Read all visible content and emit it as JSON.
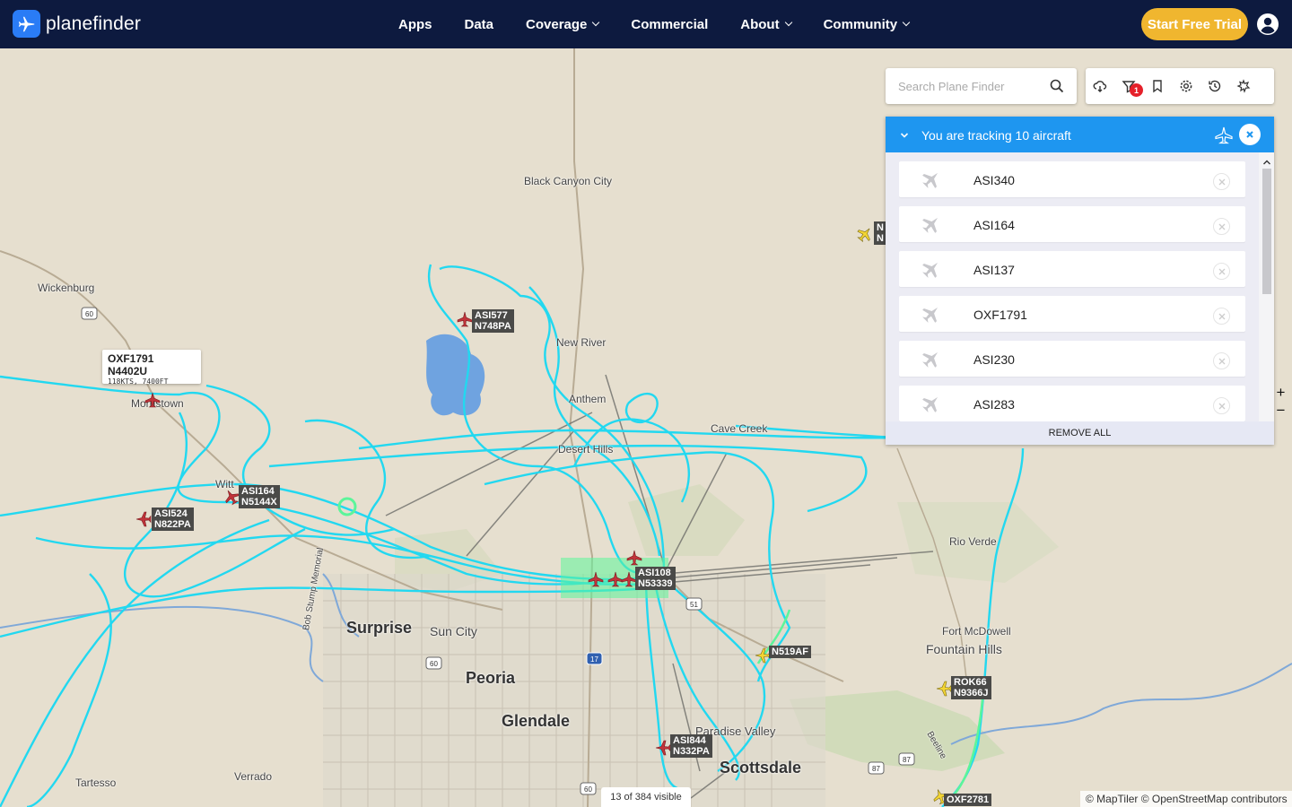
{
  "header": {
    "brand": "planefinder",
    "nav": [
      {
        "label": "Apps",
        "dropdown": false
      },
      {
        "label": "Data",
        "dropdown": false
      },
      {
        "label": "Coverage",
        "dropdown": true
      },
      {
        "label": "Commercial",
        "dropdown": false
      },
      {
        "label": "About",
        "dropdown": true
      },
      {
        "label": "Community",
        "dropdown": true
      }
    ],
    "cta": "Start Free Trial",
    "colors": {
      "bar": "#0d1a3f",
      "cta": "#f0b62f",
      "logo": "#2a7cf6"
    }
  },
  "search": {
    "placeholder": "Search Plane Finder"
  },
  "toolbar": {
    "icons": [
      "cloud-weather-icon",
      "filter-icon",
      "bookmark-icon",
      "settings-icon",
      "history-icon",
      "playback-icon"
    ],
    "filter_badge": "1"
  },
  "tracking": {
    "title": "You are tracking 10 aircraft",
    "items": [
      "ASI340",
      "ASI164",
      "ASI137",
      "OXF1791",
      "ASI230",
      "ASI283"
    ],
    "remove_all": "REMOVE ALL",
    "header_color": "#1e96f0"
  },
  "map": {
    "places": {
      "black_canyon_city": "Black Canyon City",
      "wickenburg": "Wickenburg",
      "morristown": "Morristown",
      "new_river": "New River",
      "anthem": "Anthem",
      "desert_hills": "Desert Hills",
      "cave_creek": "Cave Creek",
      "rio_verde": "Rio Verde",
      "fort_mcdowell": "Fort McDowell",
      "fountain_hills": "Fountain Hills",
      "surprise": "Surprise",
      "sun_city": "Sun City",
      "peoria": "Peoria",
      "glendale": "Glendale",
      "paradise_valley": "Paradise Valley",
      "scottsdale": "Scottsdale",
      "verrado": "Verrado",
      "tartesso": "Tartesso",
      "wittmann": "Witt",
      "bob_stump": "Bob Stump Memorial",
      "beeline": "Beeline"
    },
    "route_shields": [
      "60",
      "60",
      "51",
      "17",
      "87",
      "87",
      "60"
    ],
    "tooltip": {
      "callsign": "OXF1791 N4402U",
      "detail": "118KTS, 7400FT"
    },
    "aircraft_tags": [
      {
        "callsign": "ASI577",
        "reg": "N748PA"
      },
      {
        "callsign": "ASI164",
        "reg": "N5144X"
      },
      {
        "callsign": "ASI524",
        "reg": "N822PA"
      },
      {
        "callsign": "ASI108",
        "reg": "N53339"
      },
      {
        "callsign": "N519AF",
        "reg": ""
      },
      {
        "callsign": "ROK66",
        "reg": "N9366J"
      },
      {
        "callsign": "ASI844",
        "reg": "N332PA"
      },
      {
        "callsign": "OXF2781",
        "reg": ""
      },
      {
        "callsign": "N",
        "reg": "N"
      }
    ],
    "track_color": "#22d8f0",
    "ground_track_color": "#5cf59a",
    "visible": "13 of 384 visible",
    "attribution": "© MapTiler © OpenStreetMap contributors",
    "zoom_in": "+",
    "zoom_out": "−"
  }
}
